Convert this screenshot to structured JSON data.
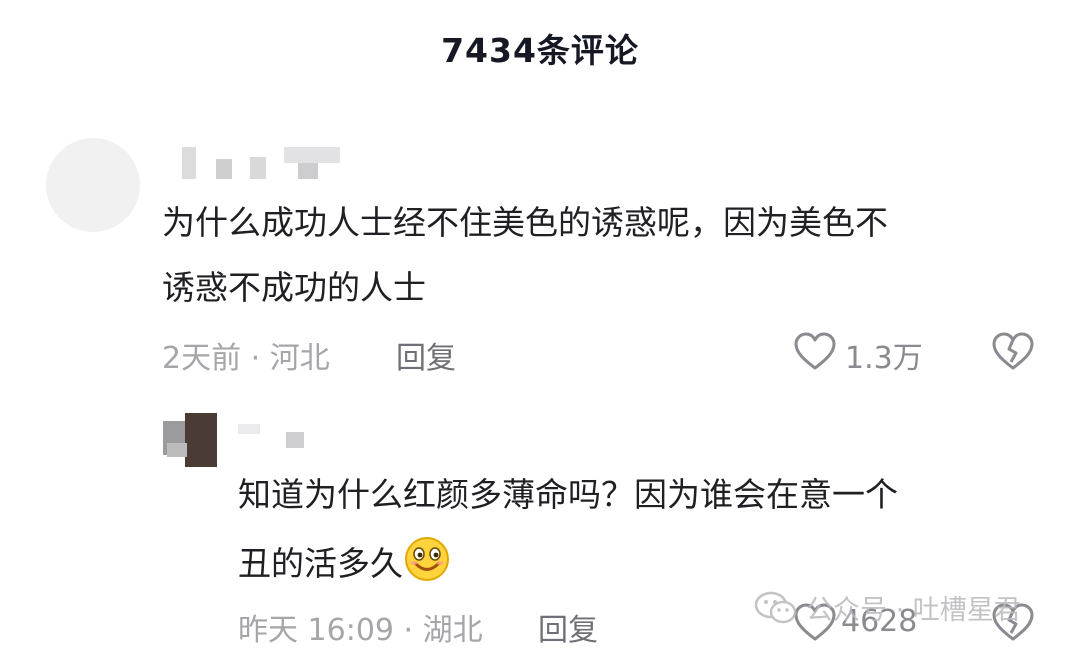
{
  "header": {
    "title": "7434条评论"
  },
  "comments": [
    {
      "text": "为什么成功人士经不住美色的诱惑呢，因为美色不诱惑不成功的人士",
      "text_line1": "为什么成功人士经不住美色的诱惑呢，因为美色不",
      "text_line2": "诱惑不成功的人士",
      "meta": "2天前 · 河北",
      "reply_label": "回复",
      "likes": "1.3万"
    },
    {
      "text": "知道为什么红颜多薄命吗？因为谁会在意一个丑的活多久",
      "text_line1": "知道为什么红颜多薄命吗？因为谁会在意一个",
      "text_line2": "丑的活多久",
      "meta": "昨天 16:09 · 湖北",
      "reply_label": "回复",
      "likes": "4628"
    }
  ],
  "watermark": {
    "text": "公众号 · 吐槽星君"
  },
  "icons": {
    "like": "heart-outline-icon",
    "dislike": "broken-heart-icon",
    "emoji": "smile-emoji-icon",
    "watermark": "wechat-icon"
  }
}
